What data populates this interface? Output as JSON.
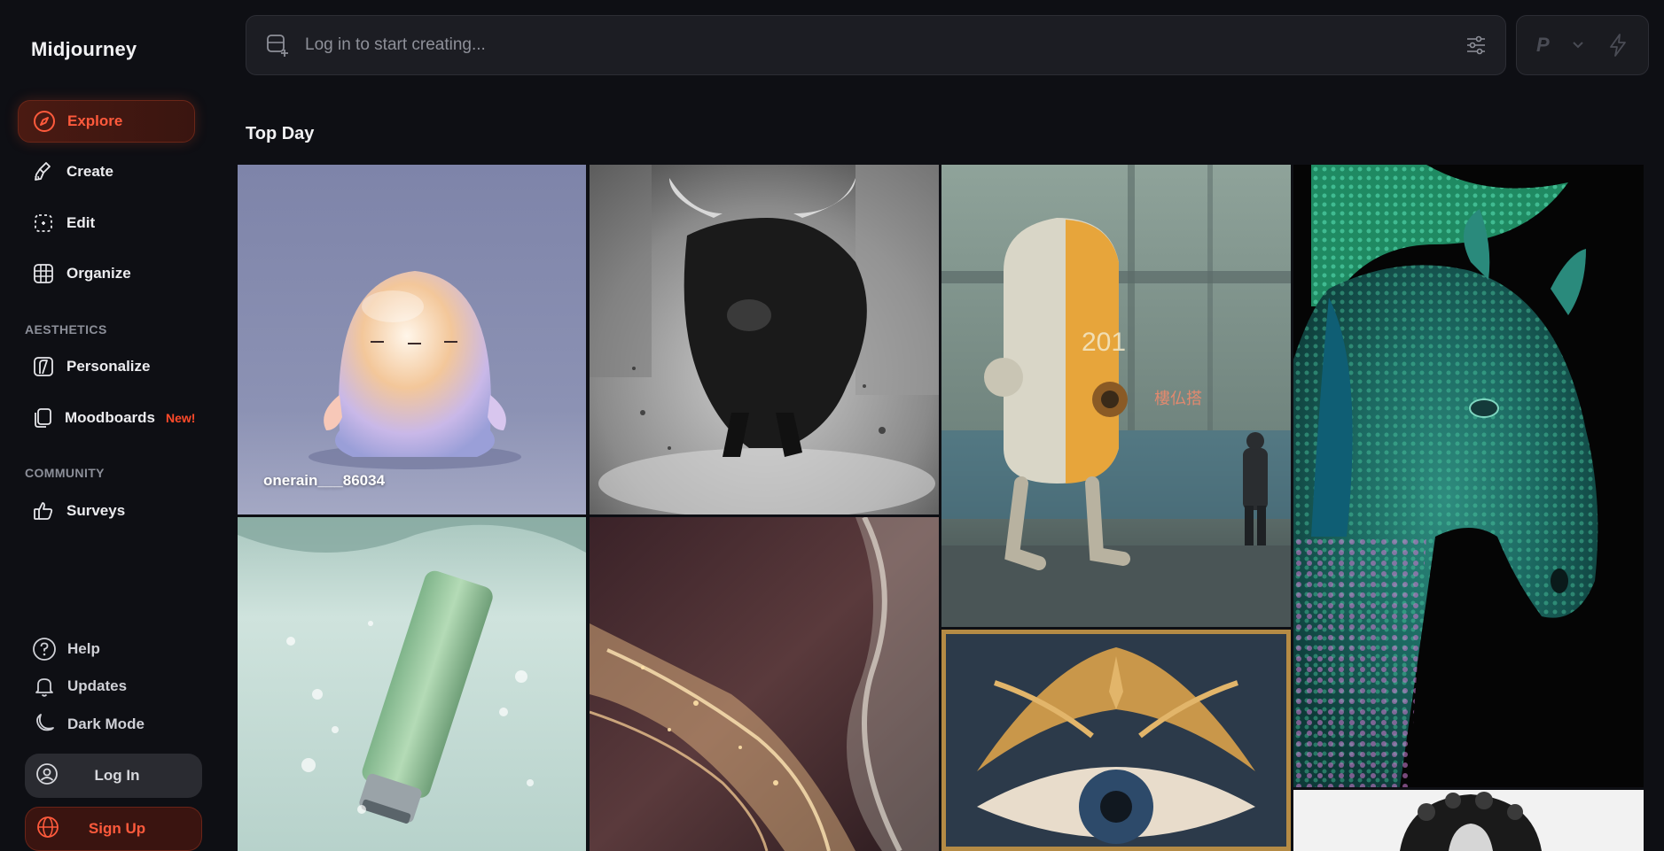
{
  "brand": {
    "name": "Midjourney"
  },
  "nav": {
    "items": [
      {
        "label": "Explore",
        "icon": "compass-icon",
        "active": true
      },
      {
        "label": "Create",
        "icon": "brush-icon"
      },
      {
        "label": "Edit",
        "icon": "edit-icon"
      },
      {
        "label": "Organize",
        "icon": "grid-icon"
      }
    ],
    "aesthetics_label": "AESTHETICS",
    "aesthetics": [
      {
        "label": "Personalize",
        "icon": "personalize-icon"
      },
      {
        "label": "Moodboards",
        "icon": "moodboard-icon",
        "badge": "New!"
      }
    ],
    "community_label": "COMMUNITY",
    "community": [
      {
        "label": "Surveys",
        "icon": "thumbs-up-icon"
      }
    ]
  },
  "bottom": {
    "help": "Help",
    "updates": "Updates",
    "dark_mode": "Dark Mode",
    "login": "Log In",
    "signup": "Sign Up"
  },
  "prompt": {
    "placeholder": "Log in to start creating...",
    "mode_label": "P"
  },
  "feed": {
    "title": "Top Day",
    "tiles": [
      {
        "subject": "glossy ghost figure",
        "author": "onerain___86034"
      },
      {
        "subject": "charging black bull"
      },
      {
        "subject": "rusty robot 201 in rain"
      },
      {
        "subject": "jeweled horse"
      },
      {
        "subject": "green tube in water"
      },
      {
        "subject": "glowing light streams"
      },
      {
        "subject": "golden winged eye"
      },
      {
        "subject": "curly hair portrait"
      }
    ]
  },
  "colors": {
    "accent": "#ff5a3c",
    "background": "#0e0f14",
    "panel": "#1c1d23"
  }
}
